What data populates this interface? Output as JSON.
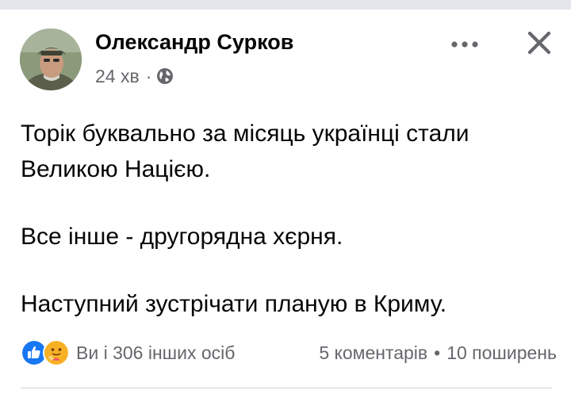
{
  "post": {
    "author": {
      "name": "Олександр Сурков",
      "avatar_icon": "user-avatar"
    },
    "meta": {
      "time": "24 хв",
      "separator": "·",
      "privacy_icon": "globe-icon"
    },
    "body": {
      "paragraphs": [
        "Торік буквально за місяць українці стали Великою Нацією.",
        "Все інше - другорядна хєрня.",
        "Наступний зустрічати планую в Криму."
      ]
    },
    "footer": {
      "reaction_icons": [
        "like-icon",
        "care-icon"
      ],
      "reactors": "Ви і 306 інших осіб",
      "comments": "5 коментарів",
      "separator": "•",
      "shares": "10 поширень"
    },
    "actions": {
      "more_icon": "more-horizontal-icon",
      "close_icon": "close-icon"
    }
  },
  "colors": {
    "background": "#ffffff",
    "top_strip": "#e4e6eb",
    "text_primary": "#050505",
    "text_secondary": "#65676b",
    "like_blue": "#1877f2",
    "care_yellow": "#f7b125"
  }
}
